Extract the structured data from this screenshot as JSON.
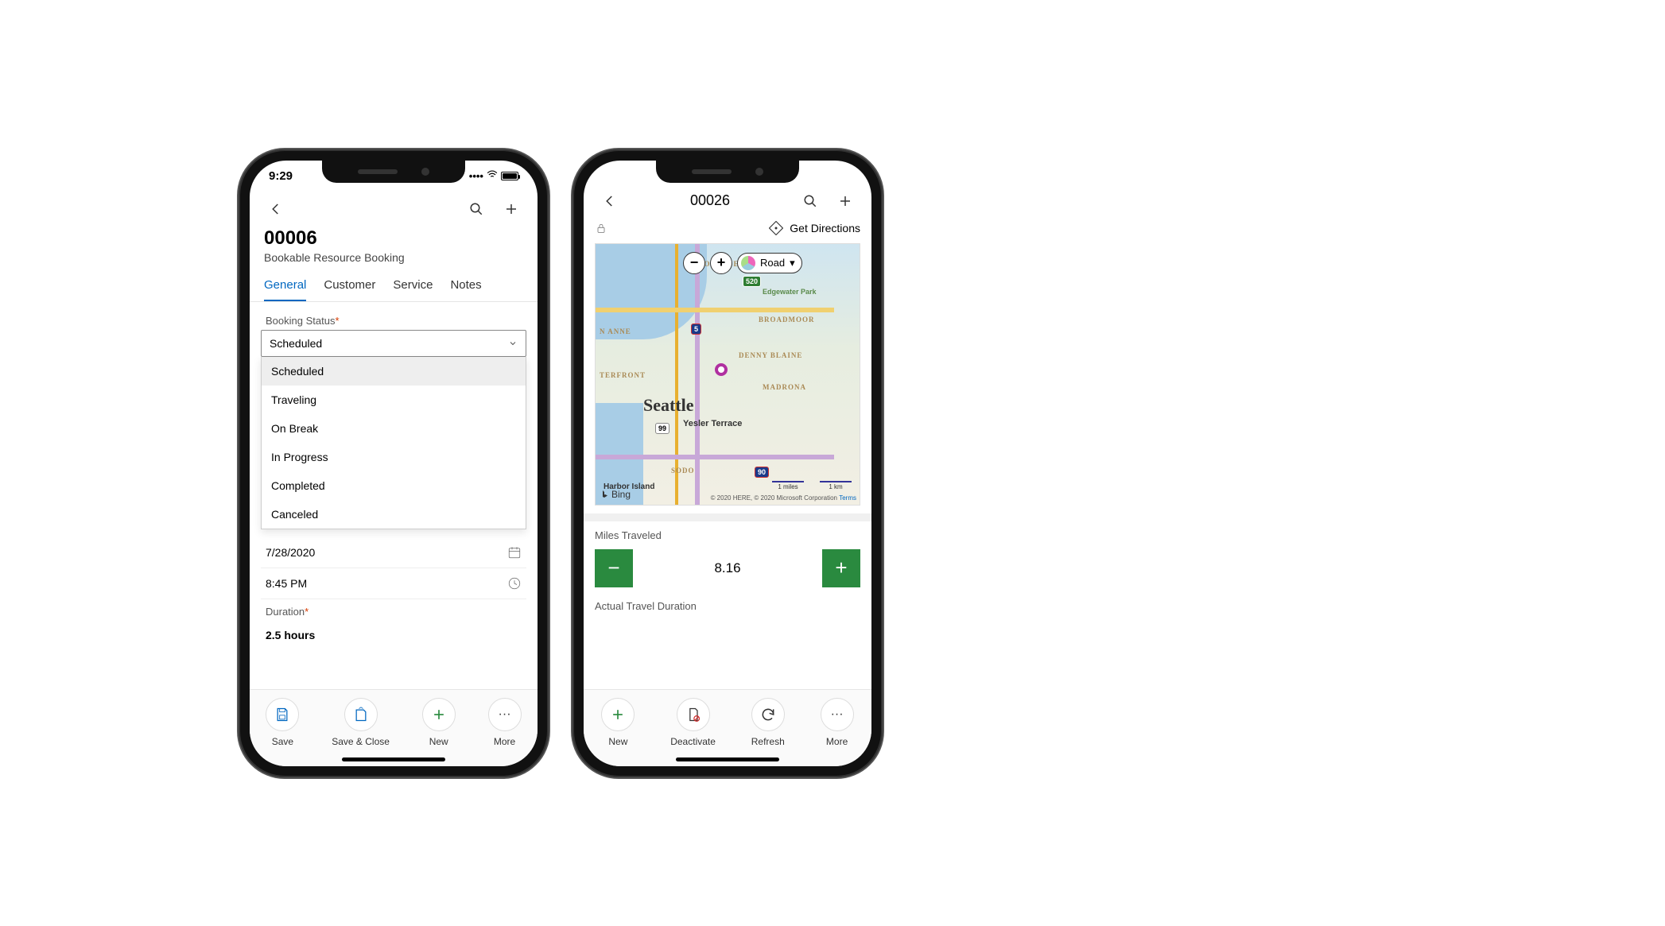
{
  "phone1": {
    "status_time": "9:29",
    "header_title": "00006",
    "header_subtitle": "Bookable Resource Booking",
    "tabs": [
      "General",
      "Customer",
      "Service",
      "Notes"
    ],
    "active_tab": 0,
    "booking_status_label": "Booking Status",
    "booking_status_value": "Scheduled",
    "booking_status_options": [
      "Scheduled",
      "Traveling",
      "On Break",
      "In Progress",
      "Completed",
      "Canceled"
    ],
    "date_value": "7/28/2020",
    "time_value": "8:45 PM",
    "duration_label": "Duration",
    "duration_value": "2.5 hours",
    "bottom": {
      "save": "Save",
      "save_close": "Save & Close",
      "new": "New",
      "more": "More"
    }
  },
  "phone2": {
    "header_title": "00026",
    "get_directions": "Get Directions",
    "map": {
      "type_label": "Road",
      "city": "Seattle",
      "neighborhoods": [
        "PORTAGE BAY",
        "BROADMOOR",
        "N ANNE",
        "Edgewater Park",
        "DENNY BLAINE",
        "MADRONA",
        "TERFRONT",
        "Yesler Terrace",
        "SODO",
        "Harbor Island"
      ],
      "highways": [
        "520",
        "5",
        "99",
        "90"
      ],
      "scale_mi": "1 miles",
      "scale_km": "1 km",
      "provider": "Bing",
      "copyright": "© 2020 HERE, © 2020 Microsoft Corporation",
      "terms": "Terms"
    },
    "miles_label": "Miles Traveled",
    "miles_value": "8.16",
    "actual_travel_label": "Actual Travel Duration",
    "bottom": {
      "new": "New",
      "deactivate": "Deactivate",
      "refresh": "Refresh",
      "more": "More"
    }
  }
}
